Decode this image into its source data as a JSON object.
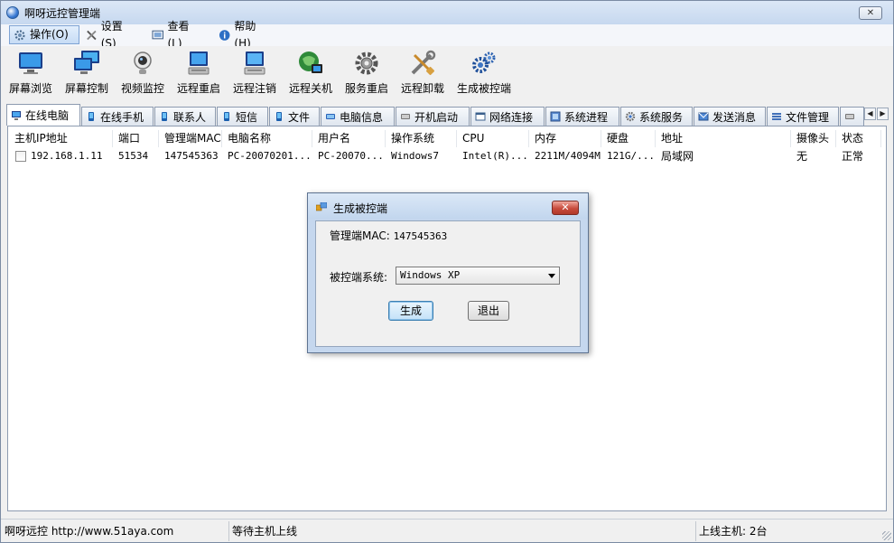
{
  "window": {
    "title": "啊呀远控管理端",
    "close_label": "✕"
  },
  "menu": [
    {
      "label": "操作(O)",
      "icon": "gear-icon"
    },
    {
      "label": "设置(S)",
      "icon": "tools-icon"
    },
    {
      "label": "查看(L)",
      "icon": "view-icon"
    },
    {
      "label": "帮助(H)",
      "icon": "help-icon"
    }
  ],
  "toolbar": [
    {
      "label": "屏幕浏览",
      "icon": "monitor-icon"
    },
    {
      "label": "屏幕控制",
      "icon": "screen-control-icon"
    },
    {
      "label": "视频监控",
      "icon": "webcam-icon"
    },
    {
      "label": "远程重启",
      "icon": "restart-icon"
    },
    {
      "label": "远程注销",
      "icon": "logoff-icon"
    },
    {
      "label": "远程关机",
      "icon": "shutdown-icon"
    },
    {
      "label": "服务重启",
      "icon": "service-gear-icon"
    },
    {
      "label": "远程卸载",
      "icon": "uninstall-tools-icon"
    },
    {
      "label": "生成被控端",
      "icon": "build-gears-icon"
    }
  ],
  "tabs": [
    {
      "label": "在线电脑",
      "icon": "computer-icon",
      "active": true
    },
    {
      "label": "在线手机",
      "icon": "phone-icon"
    },
    {
      "label": "联系人",
      "icon": "phone-icon"
    },
    {
      "label": "短信",
      "icon": "phone-icon"
    },
    {
      "label": "文件",
      "icon": "phone-icon"
    },
    {
      "label": "电脑信息",
      "icon": "info-icon"
    },
    {
      "label": "开机启动",
      "icon": "startup-icon"
    },
    {
      "label": "网络连接",
      "icon": "network-icon"
    },
    {
      "label": "系统进程",
      "icon": "process-icon"
    },
    {
      "label": "系统服务",
      "icon": "service-icon"
    },
    {
      "label": "发送消息",
      "icon": "message-icon"
    },
    {
      "label": "文件管理",
      "icon": "file-manager-icon"
    }
  ],
  "table": {
    "columns": [
      "主机IP地址",
      "端口",
      "管理端MAC",
      "电脑名称",
      "用户名",
      "操作系统",
      "CPU",
      "内存",
      "硬盘",
      "地址",
      "摄像头",
      "状态"
    ],
    "rows": [
      [
        "192.168.1.11",
        "51534",
        "147545363",
        "PC-20070201...",
        "PC-20070...",
        "Windows7",
        "Intel(R)...",
        "2211M/4094M",
        "121G/...",
        "局域网",
        "无",
        "正常"
      ]
    ]
  },
  "status": {
    "app": "啊呀远控 http://www.51aya.com",
    "message": "等待主机上线",
    "online": "上线主机: 2台"
  },
  "dialog": {
    "title": "生成被控端",
    "mac_label": "管理端MAC: ",
    "mac_value": "147545363",
    "os_label": "被控端系统:",
    "os_selected": "Windows XP",
    "generate_label": "生成",
    "exit_label": "退出",
    "close_label": "✕"
  }
}
